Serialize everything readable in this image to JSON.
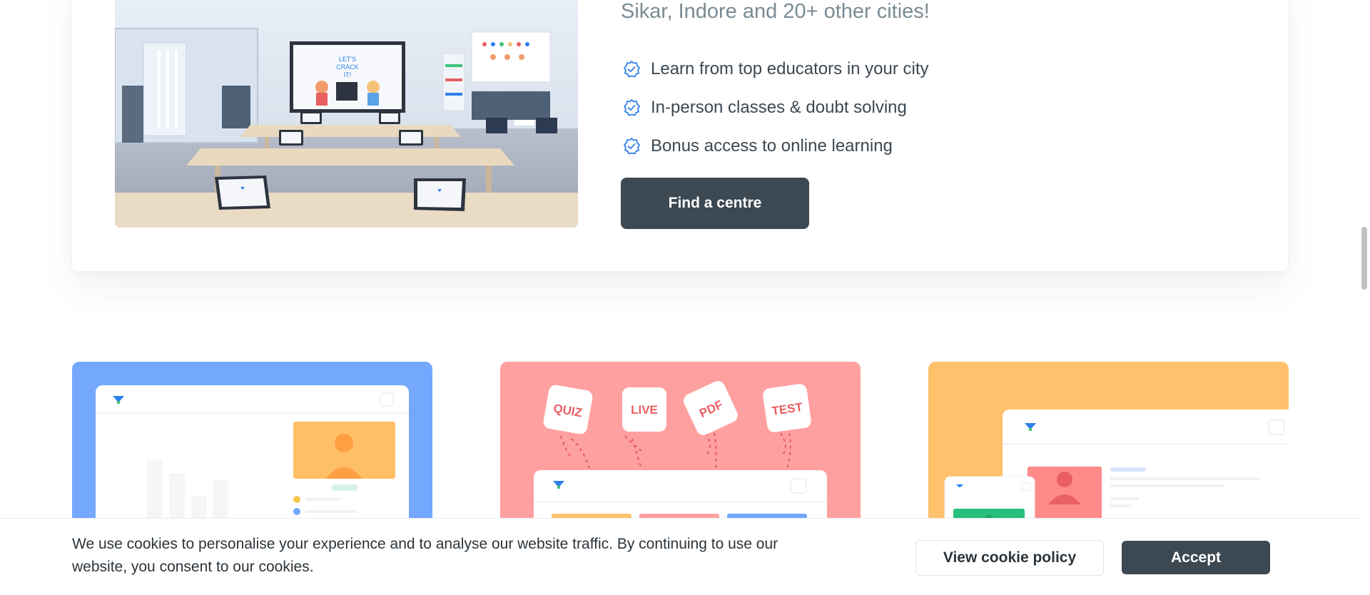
{
  "centre": {
    "cities_text": "Sikar, Indore and 20+ other cities!",
    "features": [
      "Learn from top educators in your city",
      "In-person classes & doubt solving",
      "Bonus access to online learning"
    ],
    "find_button_label": "Find a centre",
    "photo": {
      "screen_text": [
        "LET'S",
        "CRACK",
        "IT!"
      ]
    }
  },
  "tiles": {
    "pink_badges": [
      "QUIZ",
      "LIVE",
      "PDF",
      "TEST"
    ]
  },
  "cookie": {
    "message": "We use cookies to personalise your experience and to analyse our website traffic. By continuing to use our website, you consent to our cookies.",
    "policy_label": "View cookie policy",
    "accept_label": "Accept"
  },
  "colors": {
    "accent_dark": "#3c4852",
    "check_blue": "#2f80ed",
    "tile_blue": "#73a8fd",
    "tile_pink": "#ffa0a0",
    "tile_yellow": "#ffc16b"
  }
}
